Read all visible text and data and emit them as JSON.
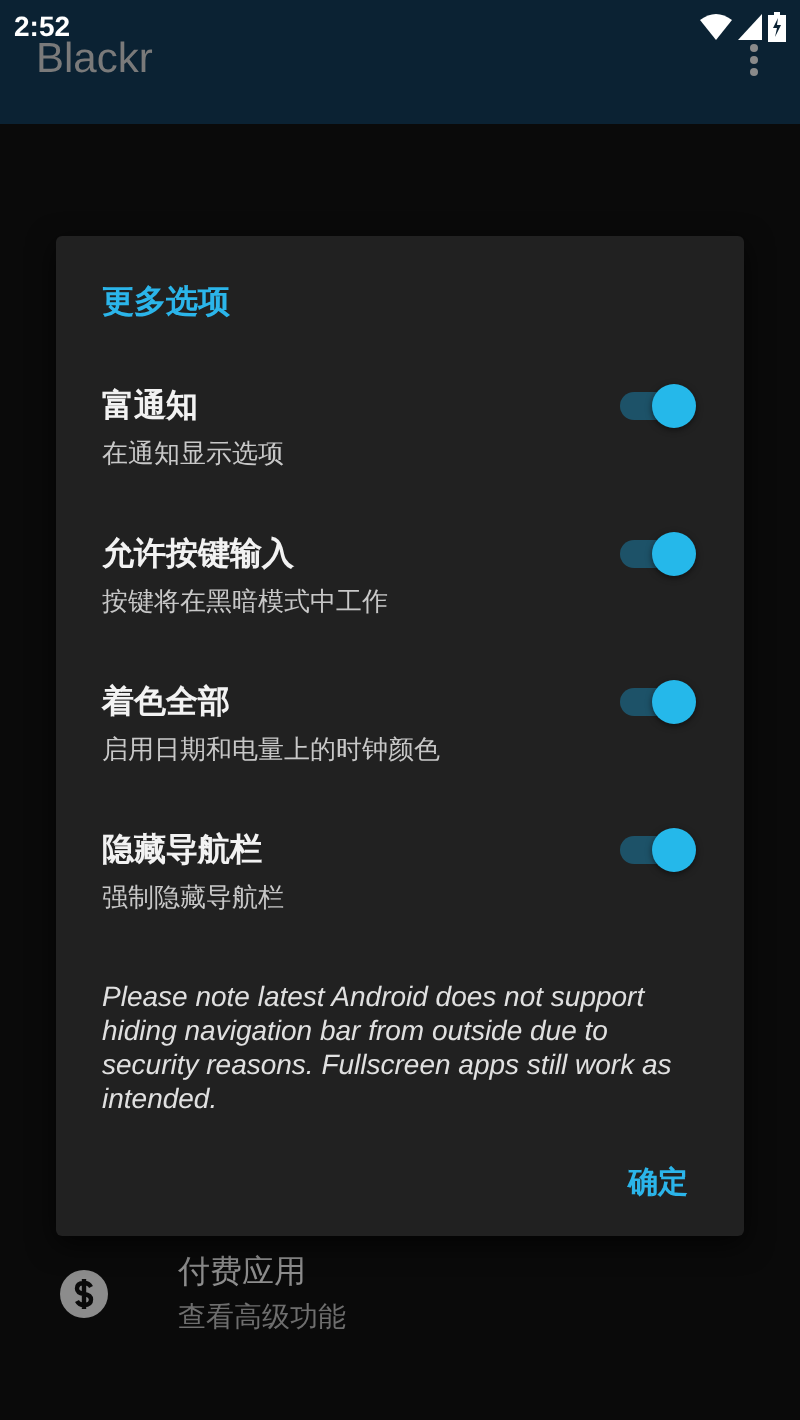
{
  "status_bar": {
    "time": "2:52"
  },
  "app_bar": {
    "title": "Blackr"
  },
  "list": [
    {
      "kind": "item",
      "title": "付费应用",
      "subtitle": "查看高级功能"
    }
  ],
  "dialog": {
    "title": "更多选项",
    "options": [
      {
        "title": "富通知",
        "subtitle": "在通知显示选项",
        "on": true
      },
      {
        "title": "允许按键输入",
        "subtitle": "按键将在黑暗模式中工作",
        "on": true
      },
      {
        "title": "着色全部",
        "subtitle": "启用日期和电量上的时钟颜色",
        "on": true
      },
      {
        "title": "隐藏导航栏",
        "subtitle": "强制隐藏导航栏",
        "on": true
      }
    ],
    "note": "Please note latest Android does not support hiding navigation bar from outside due to security reasons. Fullscreen apps still work as intended.",
    "buttons": [
      "确定"
    ]
  }
}
